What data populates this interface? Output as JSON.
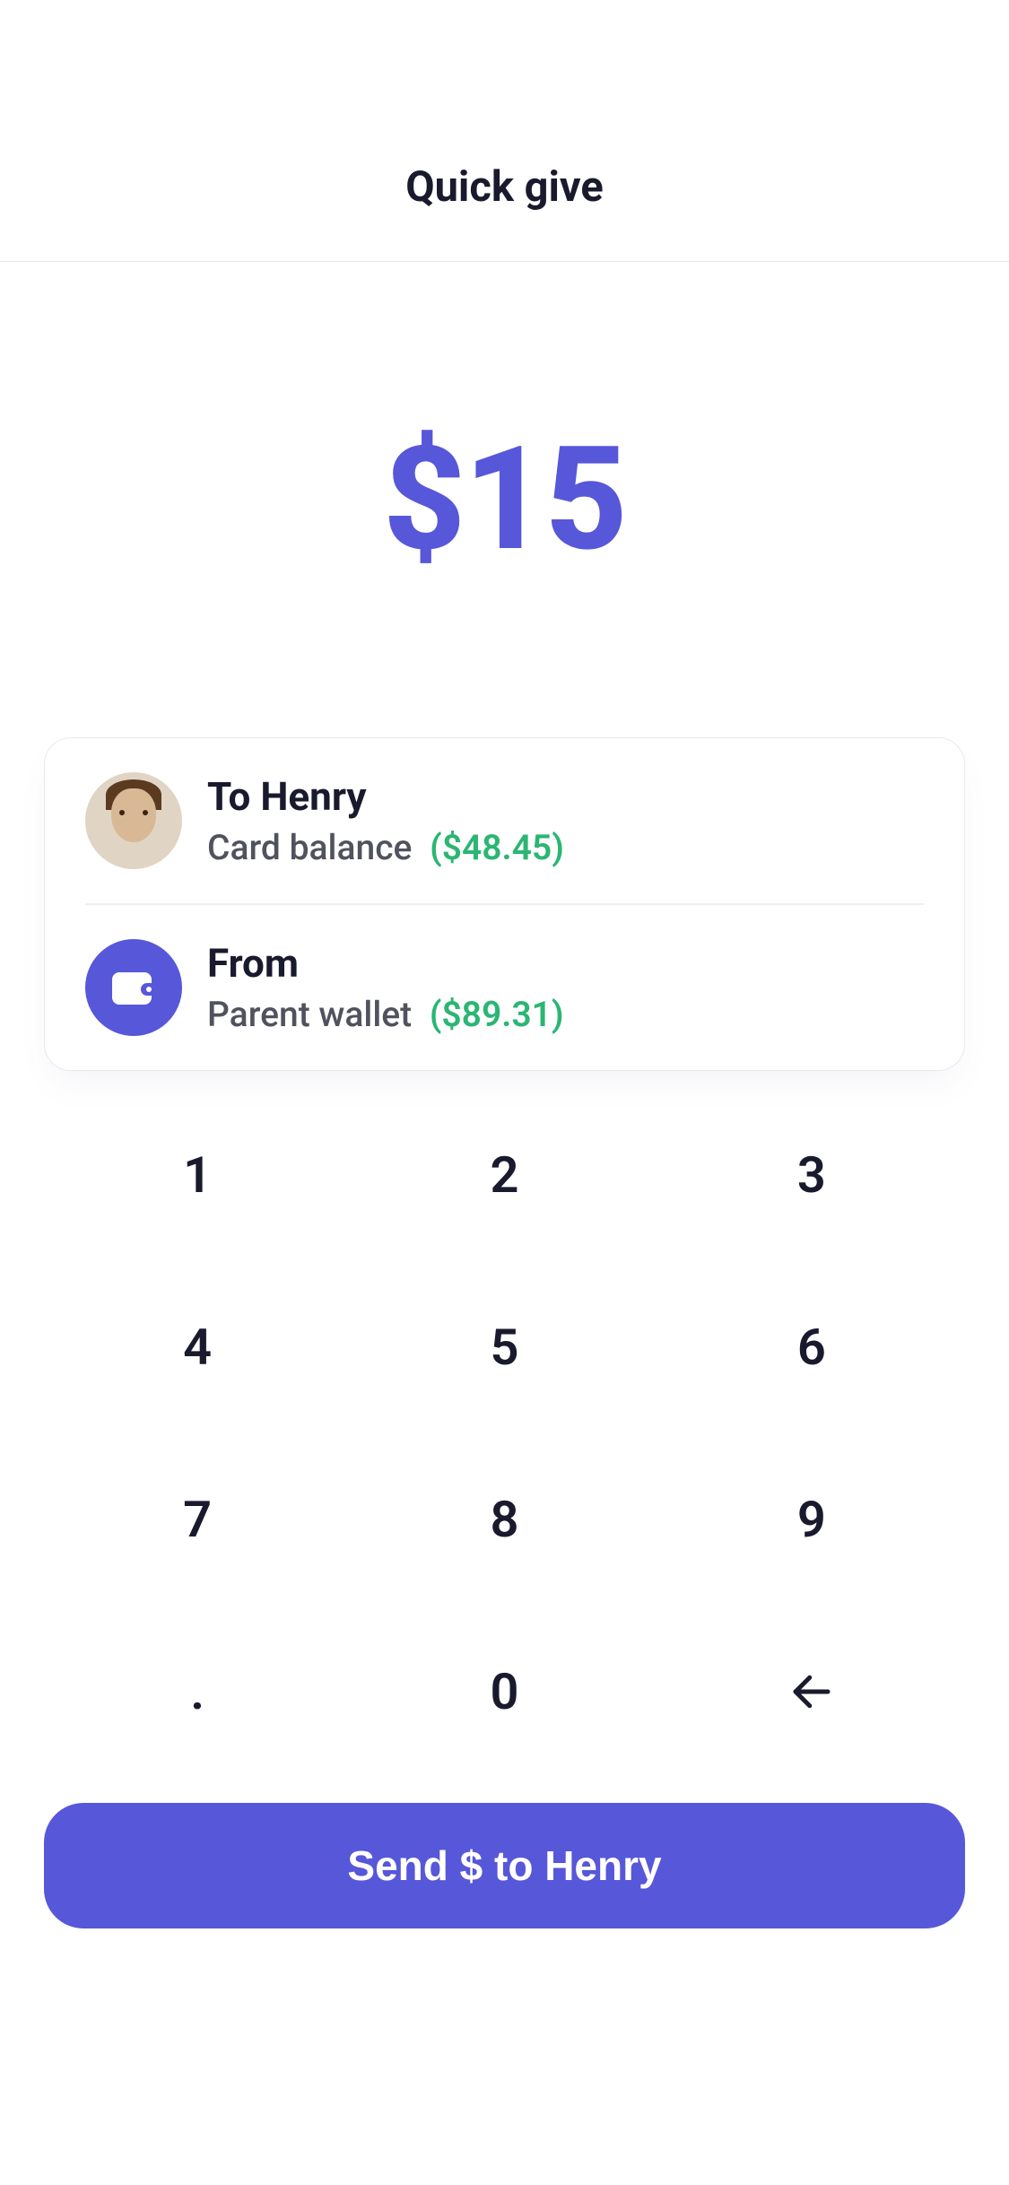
{
  "header": {
    "title": "Quick give"
  },
  "amount": {
    "display": "$15"
  },
  "recipient": {
    "title": "To Henry",
    "sub_label": "Card balance",
    "balance": "($48.45)"
  },
  "source": {
    "title": "From",
    "sub_label": "Parent wallet",
    "balance": "($89.31)"
  },
  "keypad": {
    "k1": "1",
    "k2": "2",
    "k3": "3",
    "k4": "4",
    "k5": "5",
    "k6": "6",
    "k7": "7",
    "k8": "8",
    "k9": "9",
    "dot": ".",
    "k0": "0"
  },
  "send_button": {
    "label": "Send $ to Henry"
  },
  "colors": {
    "accent": "#5757d9",
    "balance_green": "#2bb673"
  }
}
